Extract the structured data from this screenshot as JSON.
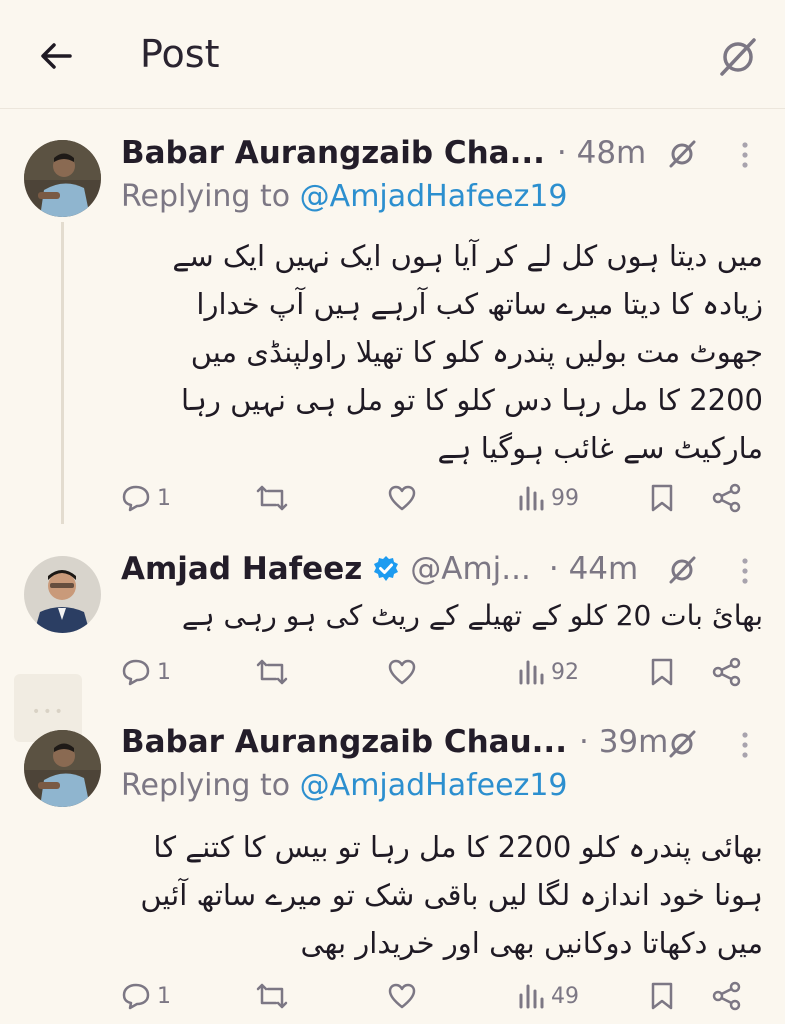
{
  "header": {
    "title": "Post"
  },
  "icons": {
    "back": "arrow-left-icon",
    "grok": "grok-icon",
    "more": "more-vertical-icon"
  },
  "colors": {
    "background": "#fbf7ef",
    "link": "#2c8fcf",
    "muted": "#7c7784",
    "verified": "#1d9bf0"
  },
  "tweets": [
    {
      "author": "Babar Aurangzaib Cha...",
      "handle": "",
      "time": "· 48m",
      "replying_prefix": "Replying to ",
      "replying_to": "@AmjadHafeez19",
      "text": "میں دیتا ہوں کل لے کر آیا ہوں ایک نہیں ایک سے زیادہ کا دیتا میرے ساتھ کب آرہے ہیں آپ خدارا جھوٹ مت بولیں پندرہ کلو کا تھیلا راولپنڈی میں 2200 کا مل رہا دس کلو کا تو مل ہی نہیں رہا مارکیٹ سے غائب ہوگیا ہے",
      "replies": "1",
      "views": "99"
    },
    {
      "author": "Amjad Hafeez",
      "handle": "@Amj...",
      "time": "· 44m",
      "verified": true,
      "text": "بھائ بات 20 کلو کے تھیلے کے ریٹ کی ہو رہی ہے",
      "replies": "1",
      "views": "92"
    },
    {
      "author": "Babar Aurangzaib Chau...",
      "handle": "",
      "time": "· 39m",
      "replying_prefix": "Replying to ",
      "replying_to": "@AmjadHafeez19",
      "text": "بھائی پندرہ کلو 2200 کا مل رہا تو بیس کا کتنے کا ہونا خود اندازہ لگا لیں باقی شک تو میرے ساتھ آئیں میں دکھاتا دوکانیں بھی اور خریدار بھی",
      "replies": "1",
      "views": "49"
    }
  ]
}
